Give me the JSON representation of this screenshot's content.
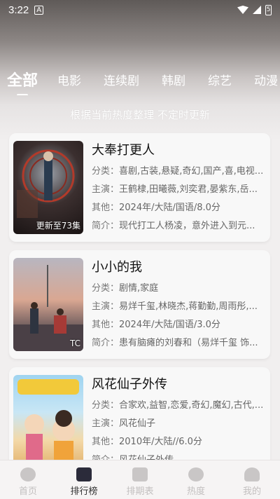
{
  "status": {
    "time": "3:22",
    "battery": "5"
  },
  "tabs": [
    "全部",
    "电影",
    "连续剧",
    "韩剧",
    "综艺",
    "动漫"
  ],
  "subtitle": "根据当前热度整理 不定时更新",
  "cards": [
    {
      "title": "大奉打更人",
      "badge": "更新至73集",
      "category_label": "分类：",
      "category": "喜剧,古装,悬疑,奇幻,国产,喜,电视...",
      "cast_label": "主演：",
      "cast": "王鹤棣,田曦薇,刘奕君,晏紫东,岳...",
      "other_label": "其他：",
      "other": "2024年/大陆/国语/8.0分",
      "intro_label": "简介：",
      "intro": "现代打工人杨凌，意外进入到元..."
    },
    {
      "title": "小小的我",
      "badge": "TC",
      "category_label": "分类：",
      "category": "剧情,家庭",
      "cast_label": "主演：",
      "cast": "易烊千玺,林晓杰,蒋勤勤,周雨彤,...",
      "other_label": "其他：",
      "other": "2024年/大陆/国语/3.0分",
      "intro_label": "简介：",
      "intro": "患有脑瘫的刘春和（易烊千玺 饰..."
    },
    {
      "title": "风花仙子外传",
      "badge": "",
      "category_label": "分类：",
      "category": "合家欢,益智,恋爱,奇幻,魔幻,古代,...",
      "cast_label": "主演：",
      "cast": "风花仙子",
      "other_label": "其他：",
      "other": "2010年/大陆//6.0分",
      "intro_label": "简介：",
      "intro": "风花仙子外传..."
    }
  ],
  "nav": [
    {
      "label": "首页",
      "icon": "home-icon"
    },
    {
      "label": "排行榜",
      "icon": "rank-icon"
    },
    {
      "label": "排期表",
      "icon": "calendar-icon"
    },
    {
      "label": "热度",
      "icon": "heat-icon"
    },
    {
      "label": "我的",
      "icon": "user-icon"
    }
  ],
  "colors": {
    "card_bg": "#f8f8f8",
    "nav_active": "#2b2b3a"
  }
}
